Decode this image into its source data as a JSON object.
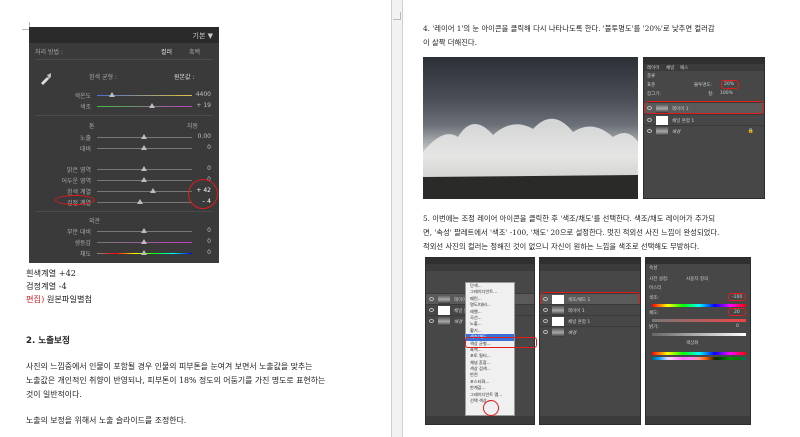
{
  "lightroom": {
    "header": "기본 ▼",
    "treatment_label": "처리 방법 :",
    "treatment_color": "컬러",
    "treatment_bw": "흑백",
    "wb_label": "흰색 균형 :",
    "wb_value": "원본값 :",
    "temp_label": "색온도",
    "temp_value": "4400",
    "tint_label": "색조",
    "tint_value": "+ 19",
    "tone_label": "톤",
    "tone_auto": "자동",
    "exposure_label": "노출",
    "exposure_value": "0.00",
    "contrast_label": "대비",
    "contrast_value": "0",
    "highlights_label": "밝은 영역",
    "highlights_value": "0",
    "shadows_label": "어두운 영역",
    "shadows_value": "0",
    "whites_label": "흰색 계열",
    "whites_value": "+ 42",
    "blacks_label": "검정 계열",
    "blacks_value": "– 4",
    "presence_label": "외관",
    "clarity_label": "부분 대비",
    "clarity_value": "0",
    "vibrance_label": "생동감",
    "vibrance_value": "0",
    "saturation_label": "채도",
    "saturation_value": "0"
  },
  "left_text": {
    "line1": "흰색계열 +42",
    "line2": "검정계열 -4",
    "line3_prefix": "편집)",
    "line3_rest": " 원본파일별첨",
    "heading": "2. 노출보정",
    "para1_l1": "사진의 느낌중에서 인물이 포함될 경우 인물의 피부톤을 눈여겨 보면서 노출값을 맞추는",
    "para1_l2": "노출값은 개인적인 취향이 반영되나, 피부톤이 18% 정도의 어둠기를 가진 명도로 표현하는",
    "para1_l3": "것이 일반적이다.",
    "para2": "노출의 보정을 위해서 노출 슬라이드를 조정한다."
  },
  "right_text": {
    "p4_l1": "4. '레이어 1'의 눈 아이콘을 클릭해 다시 나타나도록 한다. '불투명도'를 '20%'로 낮추면 컬러감",
    "p4_l2": "이 살짝 더해진다.",
    "p5_l1": "5. 이번에는 조정 레이어 아이콘을 클릭한 후 '색조/채도'를 선택한다. 색조/채도 레이어가 추가되",
    "p5_l2": "면, '속성' 팔레트에서 '색조' -100, '채도' 20으로 설정한다. 멋진 적외선 사진 느낌이 완성되었다.",
    "p5_l3": "적외선 사진의 컬러는 정해진 것이 없으니 자신이 원하는 느낌을 색조로 선택해도 무방하다."
  },
  "ps1": {
    "tab1": "레이어",
    "tab2": "채널",
    "tab3": "패스",
    "kind": "종류",
    "mode": "표준",
    "opacity_label": "불투명도:",
    "opacity_value": "20%",
    "lock_label": "잠그기:",
    "fill_label": "칠:",
    "fill_value": "100%",
    "layer1": "레이어 1",
    "layer2": "채널 혼합 1",
    "layer3": "배경"
  },
  "ps2": {
    "layer1": "레이어 1",
    "layer2": "채널 혼합 1",
    "layer3": "배경",
    "menu_items": [
      "단색...",
      "그레이디언트...",
      "패턴...",
      "명도/대비...",
      "레벨...",
      "곡선...",
      "노출...",
      "활기...",
      "색조/채도...",
      "색상 균형...",
      "흑백...",
      "포토 필터...",
      "채널 혼합...",
      "색상 검색...",
      "반전",
      "포스터화...",
      "한계값...",
      "그레이디언트 맵...",
      "선택 색상..."
    ],
    "menu_highlight": "색조/채도..."
  },
  "ps3": {
    "layer1": "색조/채도 1",
    "layer2": "레이어 1",
    "layer3": "채널 혼합 1",
    "layer4": "배경"
  },
  "props": {
    "title": "속성",
    "preset_label": "사전 설정:",
    "preset_value": "사용자 정의",
    "master": "마스터",
    "hue_label": "색조:",
    "hue_value": "-100",
    "sat_label": "채도:",
    "sat_value": "20",
    "light_label": "밝기:",
    "light_value": "0",
    "colorize": "색상화"
  },
  "colors": {
    "annotation": "#e21b1b",
    "panel_bg": "#3a3a3a",
    "ps_bg": "#474747",
    "edit_red": "#d62020"
  }
}
